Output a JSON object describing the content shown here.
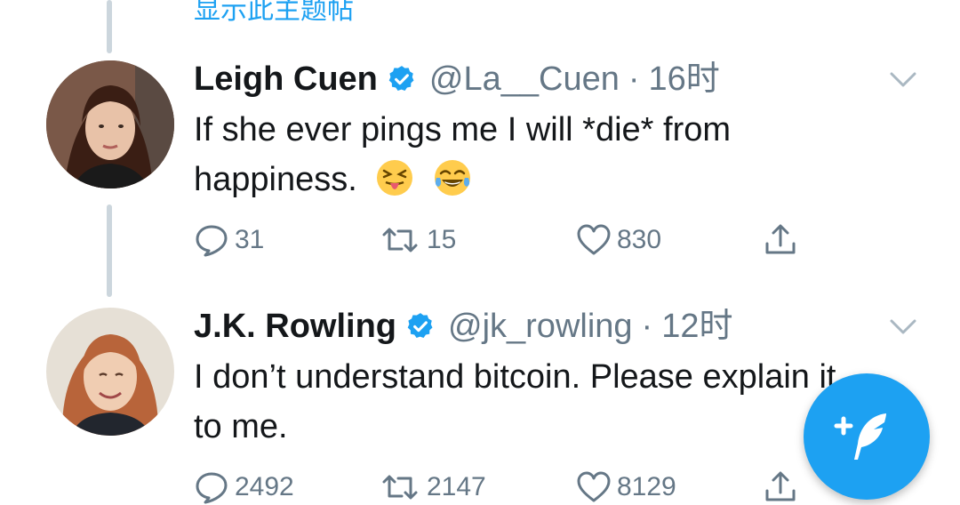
{
  "thread": {
    "show_thread_label": "显示此主题帖"
  },
  "tweets": [
    {
      "display_name": "Leigh Cuen",
      "handle": "@La__Cuen",
      "separator": "·",
      "time": "16时",
      "text_line1": "If she ever pings me I will *die* from",
      "text_line2": "happiness.",
      "emojis": [
        "squinting-tongue-emoji",
        "tears-of-joy-emoji"
      ],
      "replies": "31",
      "retweets": "15",
      "likes": "830"
    },
    {
      "display_name": "J.K. Rowling",
      "handle": "@jk_rowling",
      "separator": "·",
      "time": "12时",
      "text_line1": "I don’t understand bitcoin. Please explain it",
      "text_line2": "to me.",
      "replies": "2492",
      "retweets": "2147",
      "likes": "8129"
    }
  ],
  "colors": {
    "accent": "#1da1f2",
    "muted": "#657786",
    "text": "#14171a",
    "thread_line": "#ccd6dd"
  },
  "compose_button": {
    "icon": "compose-feather-icon"
  }
}
